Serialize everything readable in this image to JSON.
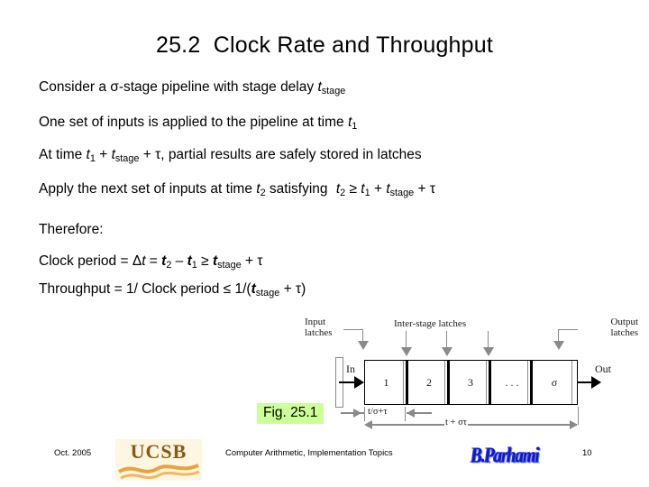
{
  "slide": {
    "title": "25.2  Clock Rate and Throughput",
    "page_number": "10"
  },
  "body": {
    "line1": {
      "a": "Consider a ",
      "sigma": "σ",
      "b": "-stage pipeline with stage delay ",
      "t": "t",
      "sub": "stage"
    },
    "line2": {
      "a": "One set of inputs is applied to the pipeline at time ",
      "t": "t",
      "sub": "1"
    },
    "line3": {
      "a": "At time ",
      "t1": "t",
      "sub1": "1",
      "plus1": " + ",
      "t2": "t",
      "sub2": "stage",
      "plus2": " + ",
      "tau": "τ",
      "b": ", partial results are safely stored in latches"
    },
    "line4": {
      "a": "Apply the next set of inputs at time ",
      "t2": "t",
      "sub2": "2",
      "b": " satisfying ",
      "t2b": "t",
      "sub2b": "2",
      "geq": " ≥ ",
      "t1": "t",
      "sub1": "1",
      "plus1": " + ",
      "tstage": "t",
      "substage": "stage",
      "plus2": " + ",
      "tau": "τ"
    },
    "therefore": "Therefore:",
    "line5": {
      "a": "Clock period  =  ",
      "delta": "Δ",
      "t": "t",
      "eq": "  =  ",
      "t2": "t",
      "sub2": "2",
      "minus": " – ",
      "t1": "t",
      "sub1": "1",
      "geq": "  ≥ ",
      "tstage": "t",
      "substage": "stage",
      "plus": " + ",
      "tau": "τ"
    },
    "line6": {
      "a": "Throughput  =  1/ Clock period  ",
      "leq": "≤",
      "b": "  1/(",
      "tstage": "t",
      "substage": "stage",
      "plus": " + ",
      "tau": "τ",
      "c": ")"
    }
  },
  "figure": {
    "caption": "Fig. 25.1",
    "input_latches_label": "Input\nlatches",
    "interstage_latches_label": "Inter-stage latches",
    "output_latches_label": "Output\nlatches",
    "in_label": "In",
    "out_label": "Out",
    "stages": [
      "1",
      "2",
      "3",
      ". . .",
      "σ"
    ],
    "dim_stage_label": "t/σ+τ",
    "dim_total_label": "t + στ"
  },
  "footer": {
    "date": "Oct. 2005",
    "title": "Computer Arithmetic, Implementation Topics",
    "page": "10",
    "ucsb_logo_text": "UCSB",
    "author_logo_text": "B.Parhami"
  },
  "colors": {
    "highlight": "#ccff99",
    "ucsb_gold": "#e8a33d",
    "ucsb_brown": "#8a5a14",
    "author_blue": "#1414cc",
    "text": "#000000"
  }
}
